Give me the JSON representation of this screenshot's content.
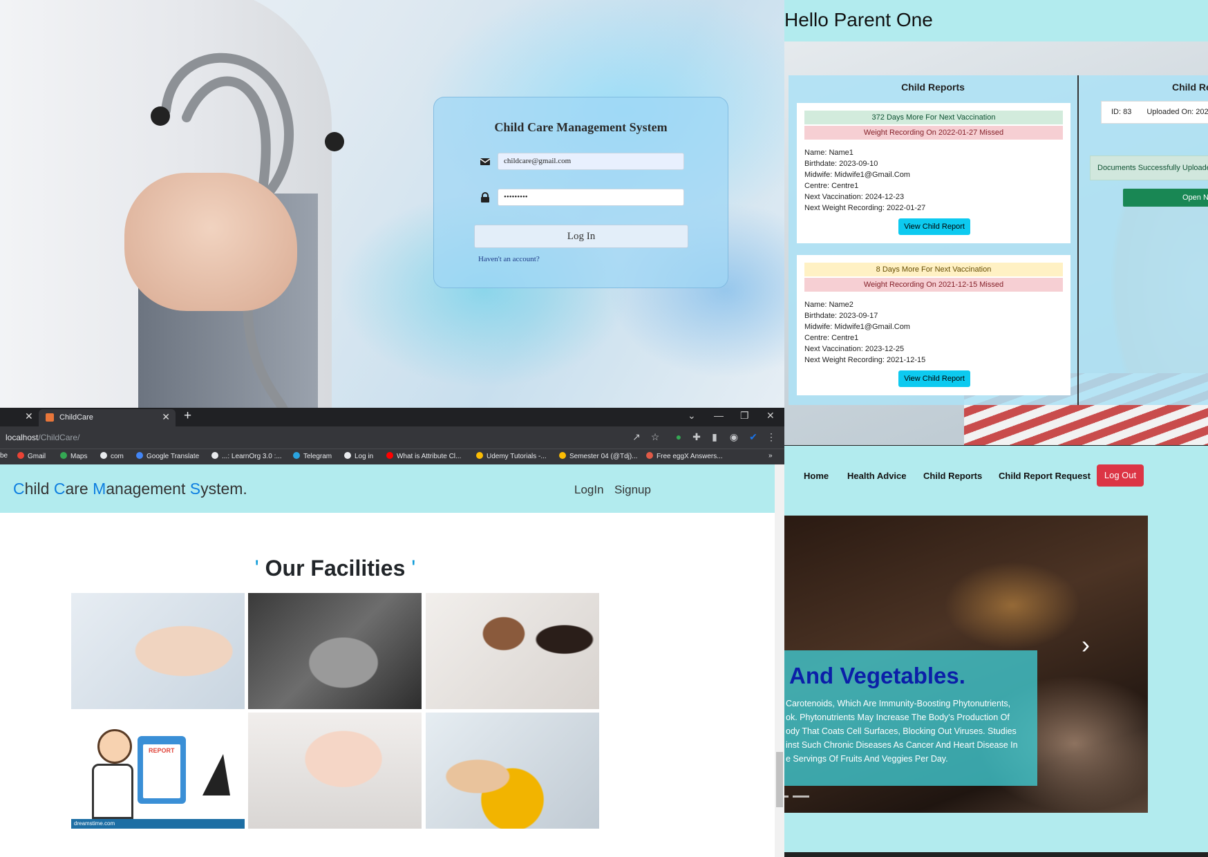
{
  "login": {
    "title": "Child Care Management System",
    "email_value": "childcare@gmail.com",
    "password_value": "•••••••••",
    "login_button": "Log In",
    "signup_link": "Haven't an account?"
  },
  "parent_dashboard": {
    "greeting": "Hello Parent One",
    "reports_heading": "Child Reports",
    "reports_heading_2": "Child Re",
    "children": [
      {
        "vaccination_alert": "372 Days More For Next Vaccination",
        "weight_alert": "Weight Recording On 2022-01-27 Missed",
        "name": "Name: Name1",
        "birthdate": "Birthdate: 2023-09-10",
        "midwife": "Midwife: Midwife1@Gmail.Com",
        "centre": "Centre: Centre1",
        "next_vaccination": "Next Vaccination: 2024-12-23",
        "next_weight": "Next Weight Recording: 2022-01-27",
        "view_button": "View Child Report"
      },
      {
        "vaccination_alert": "8 Days More For Next Vaccination",
        "weight_alert": "Weight Recording On 2021-12-15 Missed",
        "name": "Name: Name2",
        "birthdate": "Birthdate: 2023-09-17",
        "midwife": "Midwife: Midwife1@Gmail.Com",
        "centre": "Centre: Centre1",
        "next_vaccination": "Next Vaccination: 2023-12-25",
        "next_weight": "Next Weight Recording: 2021-12-15",
        "view_button": "View Child Report"
      }
    ],
    "doc_id": "ID: 83",
    "doc_uploaded": "Uploaded On: 202",
    "doc_success": "Documents Successfully Uploaded",
    "open_button": "Open N"
  },
  "browser": {
    "tab_title": "ChildCare",
    "url_host": "localhost",
    "url_path": "/ChildCare/",
    "bookmarks": [
      {
        "label": "be",
        "icon_color": "#e8eaed"
      },
      {
        "label": "Gmail",
        "icon_color": "#ea4335"
      },
      {
        "label": "Maps",
        "icon_color": "#34a853"
      },
      {
        "label": "com",
        "icon_color": "#e8eaed"
      },
      {
        "label": "Google Translate",
        "icon_color": "#4285f4"
      },
      {
        "label": "...: LearnOrg 3.0 :...",
        "icon_color": "#e8eaed"
      },
      {
        "label": "Telegram",
        "icon_color": "#2aa3df"
      },
      {
        "label": "Log in",
        "icon_color": "#e8eaed"
      },
      {
        "label": "What is Attribute Cl...",
        "icon_color": "#ff0000"
      },
      {
        "label": "Udemy Tutorials -...",
        "icon_color": "#fbbc04"
      },
      {
        "label": "Semester 04 (@Tdj)...",
        "icon_color": "#fbbc04"
      },
      {
        "label": "Free eggX Answers...",
        "icon_color": "#e05a47"
      }
    ],
    "bookmarks_more": "»"
  },
  "site": {
    "brand_parts": [
      {
        "cap": "C",
        "rest": "hild "
      },
      {
        "cap": "C",
        "rest": "are "
      },
      {
        "cap": "M",
        "rest": "anagement "
      },
      {
        "cap": "S",
        "rest": "ystem."
      }
    ],
    "nav_login": "LogIn",
    "nav_signup": "Signup",
    "facilities_quote_open": "'",
    "facilities_title": "Our Facilities",
    "facilities_quote_close": "'",
    "report_tile_text": "REPORT",
    "report_tile_footer": "dreamstime.com"
  },
  "parent_site": {
    "nav": {
      "home": "Home",
      "health_advice": "Health Advice",
      "child_reports": "Child Reports",
      "child_report_request": "Child Report Request",
      "logout": "Log Out"
    },
    "carousel": {
      "title": "And Vegetables.",
      "lines": [
        "Carotenoids, Which Are Immunity-Boosting Phytonutrients,",
        "ok. Phytonutrients May Increase The Body's Production Of",
        "ody That Coats Cell Surfaces, Blocking Out Viruses. Studies",
        "inst Such Chronic Diseases As Cancer And Heart Disease In",
        "e Servings Of Fruits And Veggies Per Day."
      ],
      "next_glyph": "›"
    }
  },
  "colors": {
    "nav_bg": "#b2ebee",
    "brand_accent": "#0d7ee0",
    "info_button": "#0dcaf0",
    "danger": "#dc3545",
    "success": "#198754"
  }
}
